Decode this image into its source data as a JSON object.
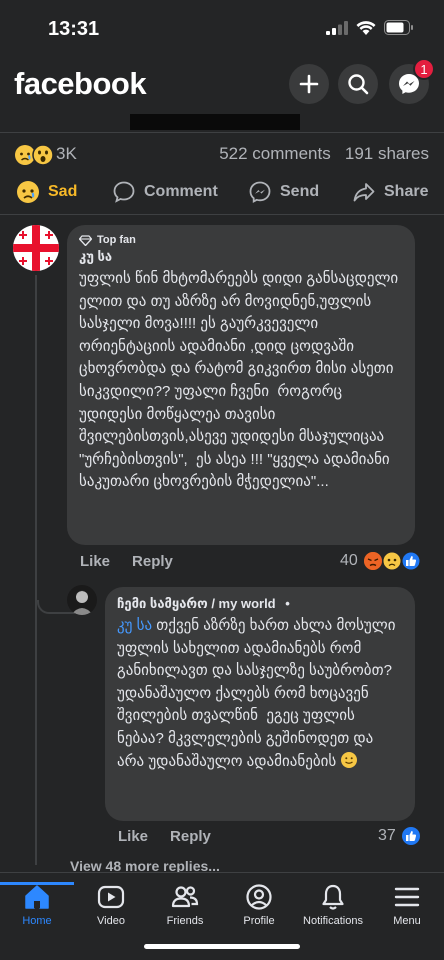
{
  "status_bar": {
    "time": "13:31"
  },
  "header": {
    "logo": "facebook",
    "messenger_badge": "1"
  },
  "summary": {
    "reaction_count": "3K",
    "comments": "522 comments",
    "shares": "191 shares"
  },
  "actions": {
    "sad": "Sad",
    "comment": "Comment",
    "send": "Send",
    "share": "Share"
  },
  "comment1": {
    "badge": "Top fan",
    "author": "კუ სა",
    "text": "უფლის წინ მხტომარეებს დიდი განსაცდელი ელით და თუ აზრზე არ მოვიდნენ,უფლის სასჯელი მოვა!!!! ეს გაურკვეველი ორიენტაციის ადამიანი ,დიდ ცოდვაში ცხოვრობდა და რატომ გიკვირთ მისი ასეთი სიკვდილი?? უფალი ჩვენი  როგორც უდიდესი მოწყალეა თავისი შვილებისთვის,ასევე უდიდესი მსაჯულიცაა \"ურჩებისთვის\",  ეს ასეა !!! \"ყველა ადამიანი საკუთარი ცხოვრების მჭედელია\"...",
    "like": "Like",
    "reply": "Reply",
    "reactions": "40"
  },
  "comment2": {
    "author": "ჩემი სამყარო / my world",
    "dot": "•",
    "mention": "კუ სა",
    "text": " თქვენ აზრზე ხართ ახლა მოსული უფლის სახელით ადამიანებს რომ განიხილავთ და სასჯელზე საუბრობთ? უდანაშაულო ქალებს რომ ხოცავენ შვილების თვალწინ  ეგეც უფლის ნებაა? მკვლელების გეშინოდეთ და არა უდანაშაულო ადამიანების ",
    "like": "Like",
    "reply": "Reply",
    "reactions": "37"
  },
  "view_more": "View 48 more replies...",
  "nav": [
    {
      "label": "Home"
    },
    {
      "label": "Video"
    },
    {
      "label": "Friends"
    },
    {
      "label": "Profile"
    },
    {
      "label": "Notifications"
    },
    {
      "label": "Menu"
    }
  ],
  "colors": {
    "accent": "#2d88ff",
    "sad": "#f7b928",
    "badge": "#e41e3f",
    "mention": "#4599ff"
  }
}
